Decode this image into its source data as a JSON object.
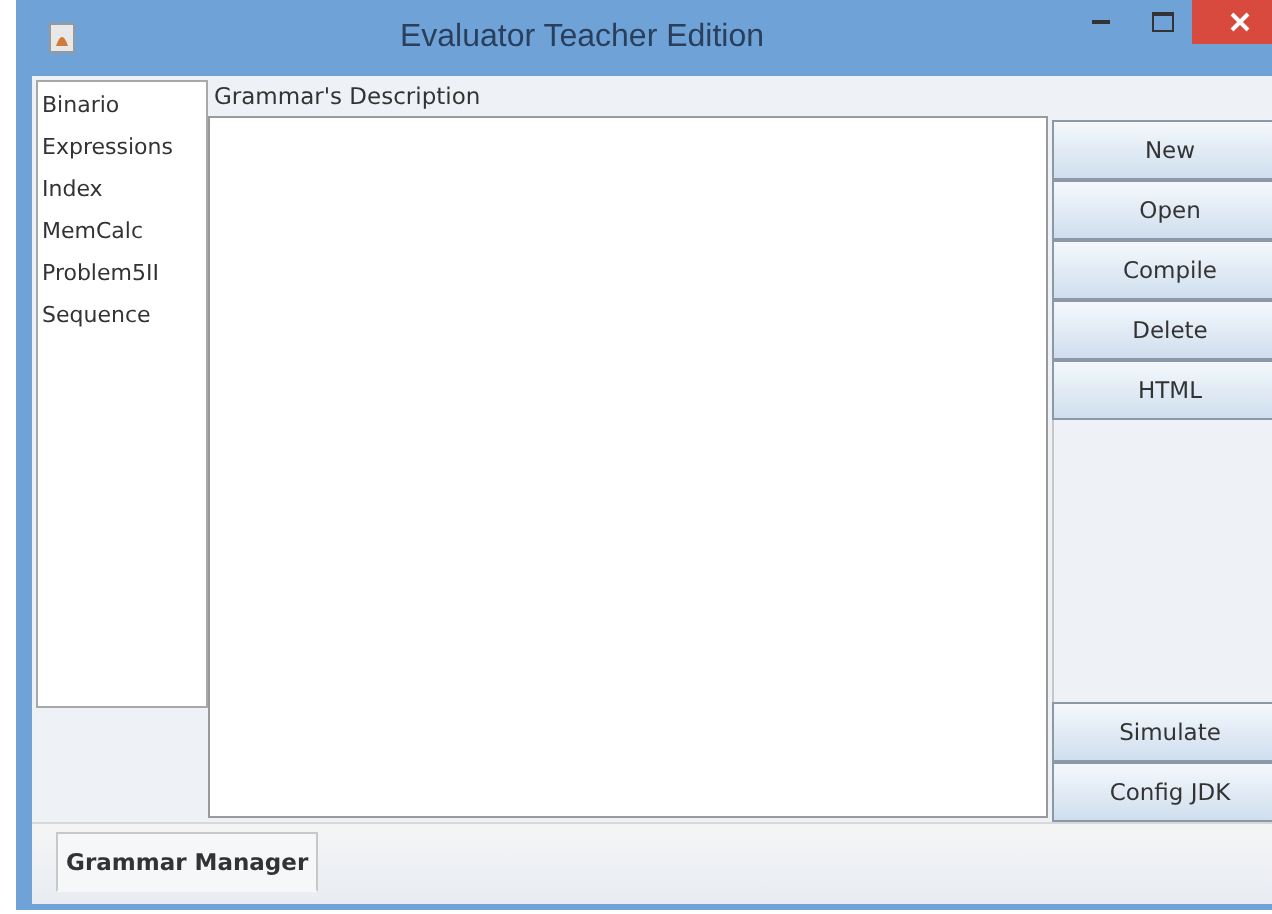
{
  "window": {
    "title": "Evaluator Teacher Edition"
  },
  "grammar_list": {
    "items": [
      {
        "label": "Binario",
        "selected": false
      },
      {
        "label": "Expressions",
        "selected": false
      },
      {
        "label": "Index",
        "selected": false
      },
      {
        "label": "MemCalc",
        "selected": false
      },
      {
        "label": "Problem5II",
        "selected": false
      },
      {
        "label": "Sequence",
        "selected": false
      }
    ]
  },
  "description": {
    "label": "Grammar's Description"
  },
  "buttons_top": [
    "New",
    "Open",
    "Compile",
    "Delete",
    "HTML"
  ],
  "buttons_bottom": [
    "Simulate",
    "Config JDK"
  ],
  "tabs": [
    {
      "label": "Grammar Manager",
      "selected": true
    }
  ]
}
